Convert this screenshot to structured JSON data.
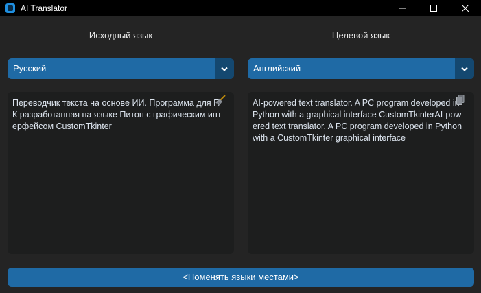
{
  "window": {
    "title": "AI Translator",
    "controls": {
      "minimize_icon": "minimize-icon",
      "maximize_icon": "maximize-icon",
      "close_icon": "close-icon"
    }
  },
  "source": {
    "label": "Исходный язык",
    "selected_language": "Русский",
    "text": "Переводчик текста на основе ИИ. Программа для ПК разработанная на языке Питон с графическим интерфейсом CustomTkinter",
    "action_icon": "broom-icon"
  },
  "target": {
    "label": "Целевой язык",
    "selected_language": "Английский",
    "text": "AI-powered text translator. A PC program developed in Python with a graphical interface CustomTkinterAI-powered text translator. A PC program developed in Python with a CustomTkinter graphical interface",
    "action_icon": "copy-icon"
  },
  "swap_button": {
    "label": "<Поменять языки местами>"
  },
  "colors": {
    "background": "#242424",
    "titlebar": "#000000",
    "accent": "#1f6aa5",
    "accent_dark": "#144870",
    "textbox": "#1d1e1e",
    "text": "#dce4ee"
  }
}
